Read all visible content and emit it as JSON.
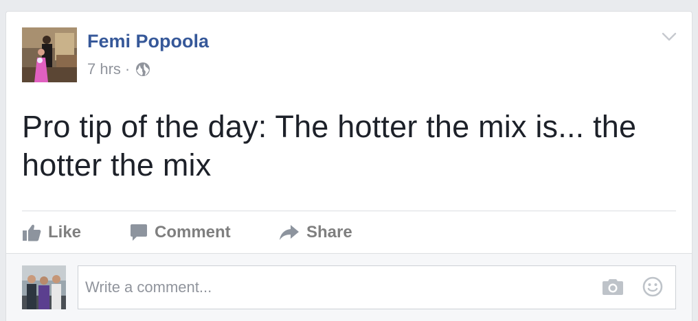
{
  "post": {
    "author": "Femi Popoola",
    "time": "7 hrs",
    "separator": "·",
    "audience_icon": "globe-icon",
    "menu_icon": "chevron-down-icon",
    "text": "Pro tip of the day: The hotter the mix is... the hotter the mix"
  },
  "actions": {
    "like": {
      "label": "Like",
      "icon": "thumbs-up-icon"
    },
    "comment": {
      "label": "Comment",
      "icon": "speech-bubble-icon"
    },
    "share": {
      "label": "Share",
      "icon": "share-arrow-icon"
    }
  },
  "comment_box": {
    "placeholder": "Write a comment...",
    "camera_icon": "camera-icon",
    "emoji_icon": "smiley-icon"
  },
  "colors": {
    "author_link": "#365899",
    "meta_text": "#90949c",
    "post_text": "#1d2129",
    "action_text": "#7f7f7f",
    "page_background": "#e9ebee"
  }
}
